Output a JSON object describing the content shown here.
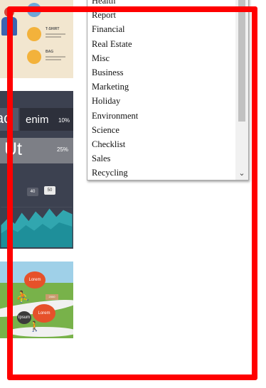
{
  "dropdown": {
    "items": [
      "Health",
      "Report",
      "Financial",
      "Real Estate",
      "Misc",
      "Business",
      "Marketing",
      "Holiday",
      "Environment",
      "Science",
      "Checklist",
      "Sales",
      "Recycling"
    ]
  },
  "thumbnails": {
    "infographic": {
      "label_1": "T-SHIRT",
      "label_2": "BAG"
    },
    "dark": {
      "word_1": "ac",
      "pct_1": "10%",
      "word_2": "Ut",
      "pct_2": "25%",
      "word_3": "enim",
      "bubble_1": "40",
      "bubble_2": "50"
    },
    "map": {
      "blob_1": "Lorem",
      "blob_2": "Lorem",
      "blob_3": "Ipsum",
      "sign_1": "2000"
    }
  },
  "colors": {
    "highlight_frame": "#ff0000"
  }
}
